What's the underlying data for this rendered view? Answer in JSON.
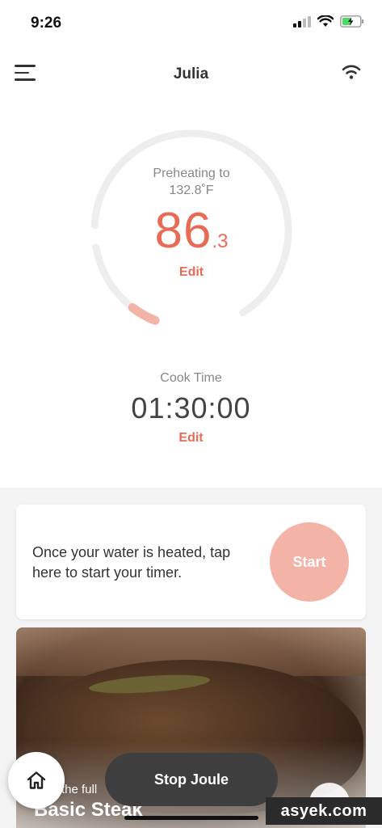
{
  "status_bar": {
    "time": "9:26"
  },
  "header": {
    "title": "Julia"
  },
  "temperature": {
    "status_label": "Preheating to",
    "target": "132.8˚F",
    "current_int": "86",
    "current_dec": ".3",
    "edit_label": "Edit",
    "progress_fraction": 0.05
  },
  "cook_time": {
    "label": "Cook Time",
    "value": "01:30:00",
    "edit_label": "Edit"
  },
  "timer_card": {
    "message": "Once your water is heated, tap here to start your timer.",
    "start_label": "Start"
  },
  "recipe_card": {
    "subtitle": "the full",
    "title": "Basic Steak"
  },
  "controls": {
    "stop_label": "Stop Joule"
  },
  "watermark": "asyek.com",
  "colors": {
    "accent": "#e86c55",
    "start_button": "#f3b3a6",
    "ring_track": "#eeeeee",
    "stop_button": "#3e3e3e"
  }
}
